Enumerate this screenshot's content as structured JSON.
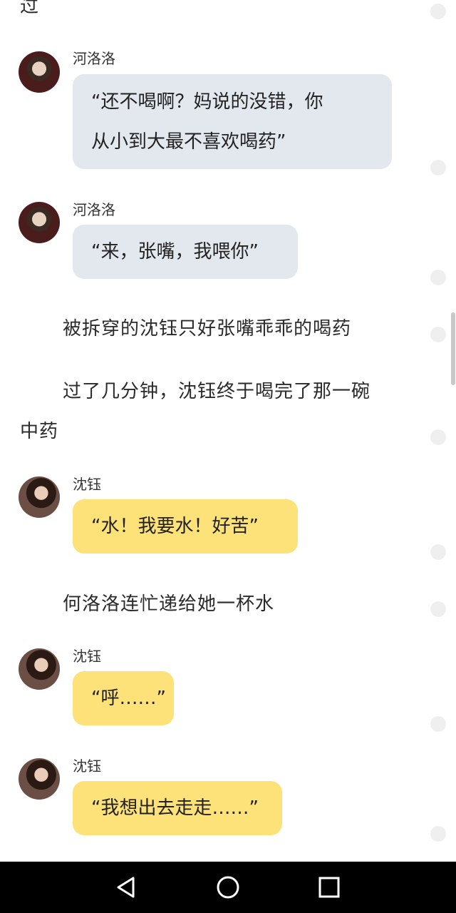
{
  "messages": {
    "m0": {
      "text": "过"
    },
    "m1": {
      "name": "河洛洛",
      "line1": "“还不喝啊？妈说的没错，你",
      "line2": "从小到大最不喜欢喝药”"
    },
    "m2": {
      "name": "河洛洛",
      "text": "“来，张嘴，我喂你”"
    },
    "n1": {
      "text": "被拆穿的沈钰只好张嘴乖乖的喝药"
    },
    "n2": {
      "line1": "过了几分钟，沈钰终于喝完了那一碗",
      "line2": "中药"
    },
    "m3": {
      "name": "沈钰",
      "text": "“水！我要水！好苦”"
    },
    "n3": {
      "text": "何洛洛连忙递给她一杯水"
    },
    "m4": {
      "name": "沈钰",
      "text": "“呼……”"
    },
    "m5": {
      "name": "沈钰",
      "text": "“我想出去走走……”"
    }
  },
  "colors": {
    "gray_bubble": "#e3e8ef",
    "yellow_bubble": "#fde27a",
    "nav_bar": "#000000"
  },
  "icons": {
    "back": "triangle-back-icon",
    "home": "circle-home-icon",
    "recent": "square-recent-icon"
  }
}
